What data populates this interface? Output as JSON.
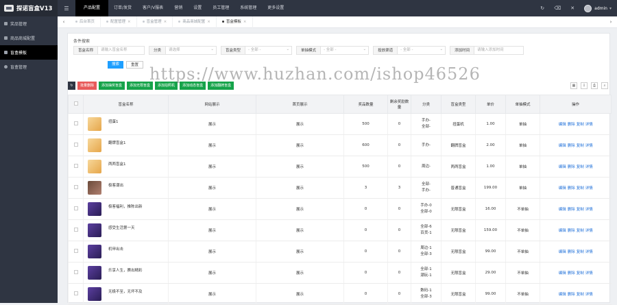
{
  "app": {
    "title": "探诺盲盒V13",
    "admin": "admin"
  },
  "topnav": [
    "产品配置",
    "订单/发货",
    "客户/V服表",
    "营销",
    "设置",
    "员工管理",
    "系统管理",
    "更多设置"
  ],
  "sidebar": [
    "奖品管理",
    "商品商城配置",
    "盲盒模板",
    "盲盒管理"
  ],
  "tabs": [
    "后台首页",
    "配置管理",
    "盲盒管理",
    "商品商城配置",
    "盲盒模板"
  ],
  "filter": {
    "title": "条件搜索",
    "name_label": "盲盒名称",
    "name_ph": "请输入盲盒名称",
    "cat_label": "分类",
    "cat_ph": "请选择",
    "type_label": "盲盒类型",
    "type_ph": "- 全部 -",
    "mode_label": "单抽模式",
    "mode_ph": "- 全部 -",
    "channel_label": "投放渠道",
    "channel_ph": "- 全部 -",
    "time_label": "添加时间",
    "time_ph": "请输入添加时间",
    "search": "搜索",
    "reset": "重置"
  },
  "toolbar": {
    "delete": "批量删除",
    "b1": "添加抽奖盲盒",
    "b2": "添加无限盲盒",
    "b3": "添加拍照机",
    "b4": "添加动态盲盒",
    "b5": "添加翻牌盲盒"
  },
  "table": {
    "headers": [
      "盲盒名称",
      "网站展示",
      "首页展示",
      "奖品数量",
      "剩余奖励数量",
      "分类",
      "盲盒类型",
      "单价",
      "单抽模式",
      "操作"
    ],
    "actions": [
      "编辑",
      "删除",
      "复制",
      "详情"
    ],
    "rows": [
      {
        "name": "扭蛋1",
        "site": "展示",
        "home": "展示",
        "count": "500",
        "left": "0",
        "cat1": "手办-",
        "cat2": "全部-",
        "type": "扭蛋机",
        "price": "1.00",
        "mode": "单抽",
        "thumb": "box"
      },
      {
        "name": "翻牌盲盒1",
        "site": "展示",
        "home": "展示",
        "count": "600",
        "left": "0",
        "cat1": "手办-",
        "cat2": "",
        "type": "翻牌盲盒",
        "price": "2.00",
        "mode": "单抽",
        "thumb": "box"
      },
      {
        "name": "两两盲盒1",
        "site": "展示",
        "home": "展示",
        "count": "500",
        "left": "0",
        "cat1": "周边-",
        "cat2": "",
        "type": "两两盲盒",
        "price": "1.00",
        "mode": "单抽",
        "thumb": "box"
      },
      {
        "name": "极客潮出",
        "site": "展示",
        "home": "展示",
        "count": "3",
        "left": "3",
        "cat1": "全部-",
        "cat2": "手办-",
        "type": "普通盲盒",
        "price": "199.00",
        "mode": "单抽",
        "thumb": "pic"
      },
      {
        "name": "极客福利，推陈出新",
        "site": "展示",
        "home": "展示",
        "count": "0",
        "left": "0",
        "cat1": "手办-0",
        "cat2": "全部-0",
        "type": "无限盲盒",
        "price": "16.00",
        "mode": "不单抽",
        "thumb": "purple"
      },
      {
        "name": "感受生活第一天",
        "site": "展示",
        "home": "展示",
        "count": "0",
        "left": "0",
        "cat1": "全部-6",
        "cat2": "百货-1",
        "type": "无限盲盒",
        "price": "159.00",
        "mode": "不单抽",
        "thumb": "purple"
      },
      {
        "name": "机甲出击",
        "site": "展示",
        "home": "展示",
        "count": "0",
        "left": "0",
        "cat1": "周边-1",
        "cat2": "全部-3",
        "type": "无限盲盒",
        "price": "99.00",
        "mode": "不单抽",
        "thumb": "purple"
      },
      {
        "name": "乐享人生，赛出精彩",
        "site": "展示",
        "home": "展示",
        "count": "0",
        "left": "0",
        "cat1": "全部-1",
        "cat2": "潮玩-1",
        "type": "无限盲盒",
        "price": "29.00",
        "mode": "不单抽",
        "thumb": "purple"
      },
      {
        "name": "无极不至，无坏不及",
        "site": "展示",
        "home": "展示",
        "count": "0",
        "left": "0",
        "cat1": "数码-1",
        "cat2": "全部-3",
        "type": "无限盲盒",
        "price": "99.00",
        "mode": "不单抽",
        "thumb": "purple"
      }
    ]
  },
  "watermark": "https://www.huzhan.com/ishop46526"
}
